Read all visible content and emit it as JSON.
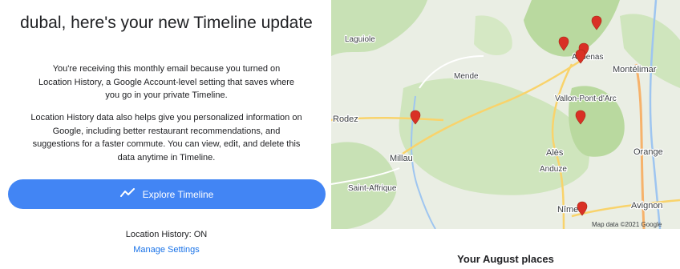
{
  "email": {
    "title": "dubal, here's your new Timeline update",
    "paragraph1": "You're receiving this monthly email because you turned on Location History, a Google Account-level setting that saves where you go in your private Timeline.",
    "paragraph2": "Location History data also helps give you personalized information on Google, including better restaurant recommendations, and suggestions for a faster commute. You can view, edit, and delete this data anytime in Timeline.",
    "button_label": "Explore Timeline",
    "button_icon": "timeline-icon",
    "status": "Location History: ON",
    "manage_link": "Manage Settings",
    "accent_color": "#4285f4",
    "link_color": "#1a73e8"
  },
  "map": {
    "cities": [
      "Laguiole",
      "Mende",
      "Aubenas",
      "Montélimar",
      "Vallon-Pont-d'Arc",
      "Rodez",
      "Alès",
      "Orange",
      "Millau",
      "Anduze",
      "Saint-Affrique",
      "Nîmes",
      "Avignon"
    ],
    "attribution": "Map data ©2021 Google",
    "pin_color": "#d93025",
    "pin_count": 7
  },
  "section": {
    "heading": "Your August places"
  }
}
